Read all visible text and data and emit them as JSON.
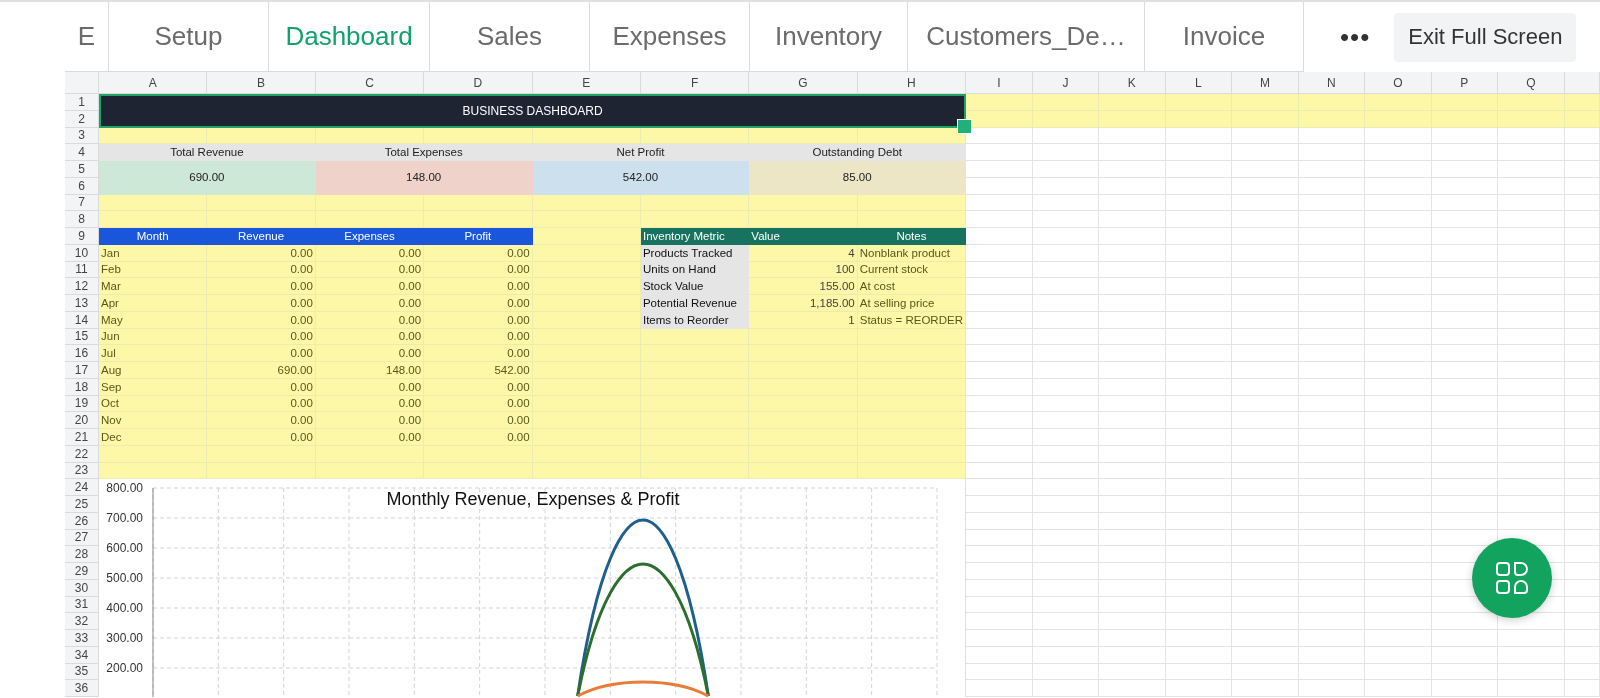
{
  "tabs": [
    {
      "label": "E",
      "selected": false
    },
    {
      "label": "Setup",
      "selected": false
    },
    {
      "label": "Dashboard",
      "selected": true
    },
    {
      "label": "Sales",
      "selected": false
    },
    {
      "label": "Expenses",
      "selected": false
    },
    {
      "label": "Inventory",
      "selected": false
    },
    {
      "label": "Customers_De…",
      "selected": false
    },
    {
      "label": "Invoice",
      "selected": false
    }
  ],
  "more_button": {
    "label": "•••"
  },
  "exit_button": {
    "label": "Exit Full Screen"
  },
  "sheet": {
    "columns": [
      "A",
      "B",
      "C",
      "D",
      "E",
      "F",
      "G",
      "H",
      "I",
      "J",
      "K",
      "L",
      "M",
      "N",
      "O",
      "P",
      "Q"
    ],
    "rows": [
      "1",
      "2",
      "3",
      "4",
      "5",
      "6",
      "7",
      "8",
      "9",
      "10",
      "11",
      "12",
      "13",
      "14",
      "15",
      "16",
      "17",
      "18",
      "19",
      "20",
      "21",
      "22",
      "23",
      "24",
      "25",
      "26",
      "27",
      "28",
      "29",
      "30",
      "31",
      "32",
      "33",
      "34",
      "35",
      "36"
    ]
  },
  "title": "BUSINESS DASHBOARD",
  "kpis": [
    {
      "label": "Total Revenue",
      "value": "690.00",
      "color": "#cde8d6"
    },
    {
      "label": "Total Expenses",
      "value": "148.00",
      "color": "#efd3cb"
    },
    {
      "label": "Net Profit",
      "value": "542.00",
      "color": "#cde0ee"
    },
    {
      "label": "Outstanding Debt",
      "value": "85.00",
      "color": "#ece5c6"
    }
  ],
  "monthly_table": {
    "columns": [
      "Month",
      "Revenue",
      "Expenses",
      "Profit"
    ],
    "rows": [
      [
        "Jan",
        "0.00",
        "0.00",
        "0.00"
      ],
      [
        "Feb",
        "0.00",
        "0.00",
        "0.00"
      ],
      [
        "Mar",
        "0.00",
        "0.00",
        "0.00"
      ],
      [
        "Apr",
        "0.00",
        "0.00",
        "0.00"
      ],
      [
        "May",
        "0.00",
        "0.00",
        "0.00"
      ],
      [
        "Jun",
        "0.00",
        "0.00",
        "0.00"
      ],
      [
        "Jul",
        "0.00",
        "0.00",
        "0.00"
      ],
      [
        "Aug",
        "690.00",
        "148.00",
        "542.00"
      ],
      [
        "Sep",
        "0.00",
        "0.00",
        "0.00"
      ],
      [
        "Oct",
        "0.00",
        "0.00",
        "0.00"
      ],
      [
        "Nov",
        "0.00",
        "0.00",
        "0.00"
      ],
      [
        "Dec",
        "0.00",
        "0.00",
        "0.00"
      ]
    ]
  },
  "inventory_table": {
    "columns": [
      "Inventory Metric",
      "Value",
      "Notes"
    ],
    "rows": [
      [
        "Products Tracked",
        "4",
        "Nonblank product"
      ],
      [
        "Units on Hand",
        "100",
        "Current stock"
      ],
      [
        "Stock Value",
        "155.00",
        "At cost"
      ],
      [
        "Potential Revenue",
        "1,185.00",
        "At selling price"
      ],
      [
        "Items to Reorder",
        "1",
        "Status = REORDER"
      ]
    ]
  },
  "chart": {
    "title": "Monthly Revenue, Expenses & Profit",
    "y_tick_labels": [
      "800.00",
      "700.00",
      "600.00",
      "500.00",
      "400.00",
      "300.00",
      "200.00"
    ]
  }
}
